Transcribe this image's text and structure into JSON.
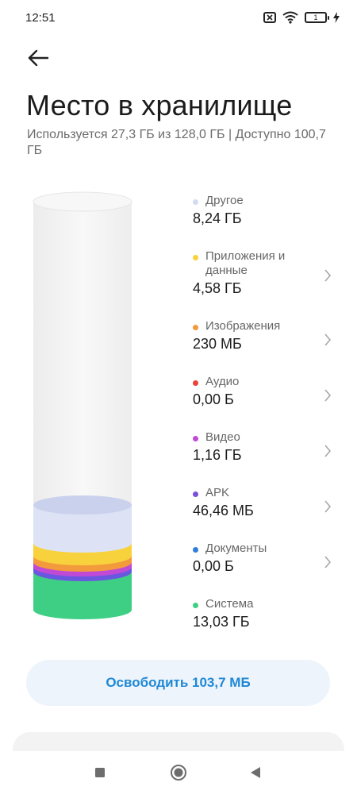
{
  "status_bar": {
    "time": "12:51",
    "battery_level": "1"
  },
  "header": {
    "title": "Место в хранилище",
    "summary": "Используется 27,3 ГБ из 128,0 ГБ | Доступно 100,7 ГБ"
  },
  "categories": [
    {
      "name": "Другое",
      "size": "8,24 ГБ",
      "color": "#d3dbf0",
      "chevron": false
    },
    {
      "name": "Приложения и данные",
      "size": "4,58 ГБ",
      "color": "#f8d23c",
      "chevron": true
    },
    {
      "name": "Изображения",
      "size": "230 МБ",
      "color": "#f39a3c",
      "chevron": true
    },
    {
      "name": "Аудио",
      "size": "0,00 Б",
      "color": "#e5453c",
      "chevron": true
    },
    {
      "name": "Видео",
      "size": "1,16 ГБ",
      "color": "#c04ad6",
      "chevron": true
    },
    {
      "name": "APK",
      "size": "46,46 МБ",
      "color": "#7a4fdc",
      "chevron": true
    },
    {
      "name": "Документы",
      "size": "0,00 Б",
      "color": "#2f7fd9",
      "chevron": true
    },
    {
      "name": "Система",
      "size": "13,03 ГБ",
      "color": "#3ecf85",
      "chevron": false
    }
  ],
  "actions": {
    "free_label": "Освободить 103,7 МБ"
  },
  "colors": {
    "accent": "#1e88d6",
    "cylinder_empty": "#f4f4f4"
  },
  "icons": {
    "back": "arrow-left-icon",
    "chevron": "chevron-right-icon",
    "nav_recent": "square-icon",
    "nav_home": "circle-icon",
    "nav_back": "triangle-left-icon"
  }
}
